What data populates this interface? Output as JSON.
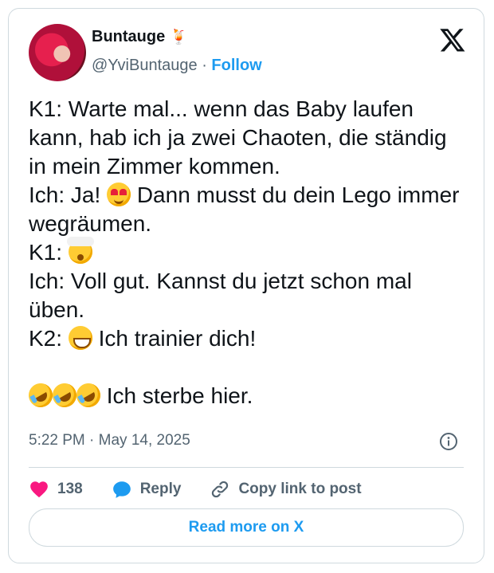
{
  "author": {
    "name": "Buntauge",
    "name_emoji": "🍹",
    "handle": "@YviBuntauge",
    "separator": "·",
    "follow_label": "Follow"
  },
  "tweet": {
    "line1": "K1: Warte mal... wenn das Baby laufen kann, hab ich ja zwei Chaoten, die ständig in mein Zimmer kommen.",
    "line2a": "Ich: Ja!",
    "line2b": "Dann musst du dein Lego immer wegräumen.",
    "line3": "K1:",
    "line4": "Ich: Voll gut. Kannst du jetzt schon mal üben.",
    "line5a": "K2:",
    "line5b": "Ich trainier dich!",
    "line6": "Ich sterbe hier."
  },
  "timestamp": "5:22 PM · May 14, 2025",
  "actions": {
    "likes_count": "138",
    "reply_label": "Reply",
    "copy_label": "Copy link to post"
  },
  "read_more_label": "Read more on X",
  "colors": {
    "accent": "#1d9bf0",
    "heart": "#f91880",
    "muted": "#536471"
  }
}
